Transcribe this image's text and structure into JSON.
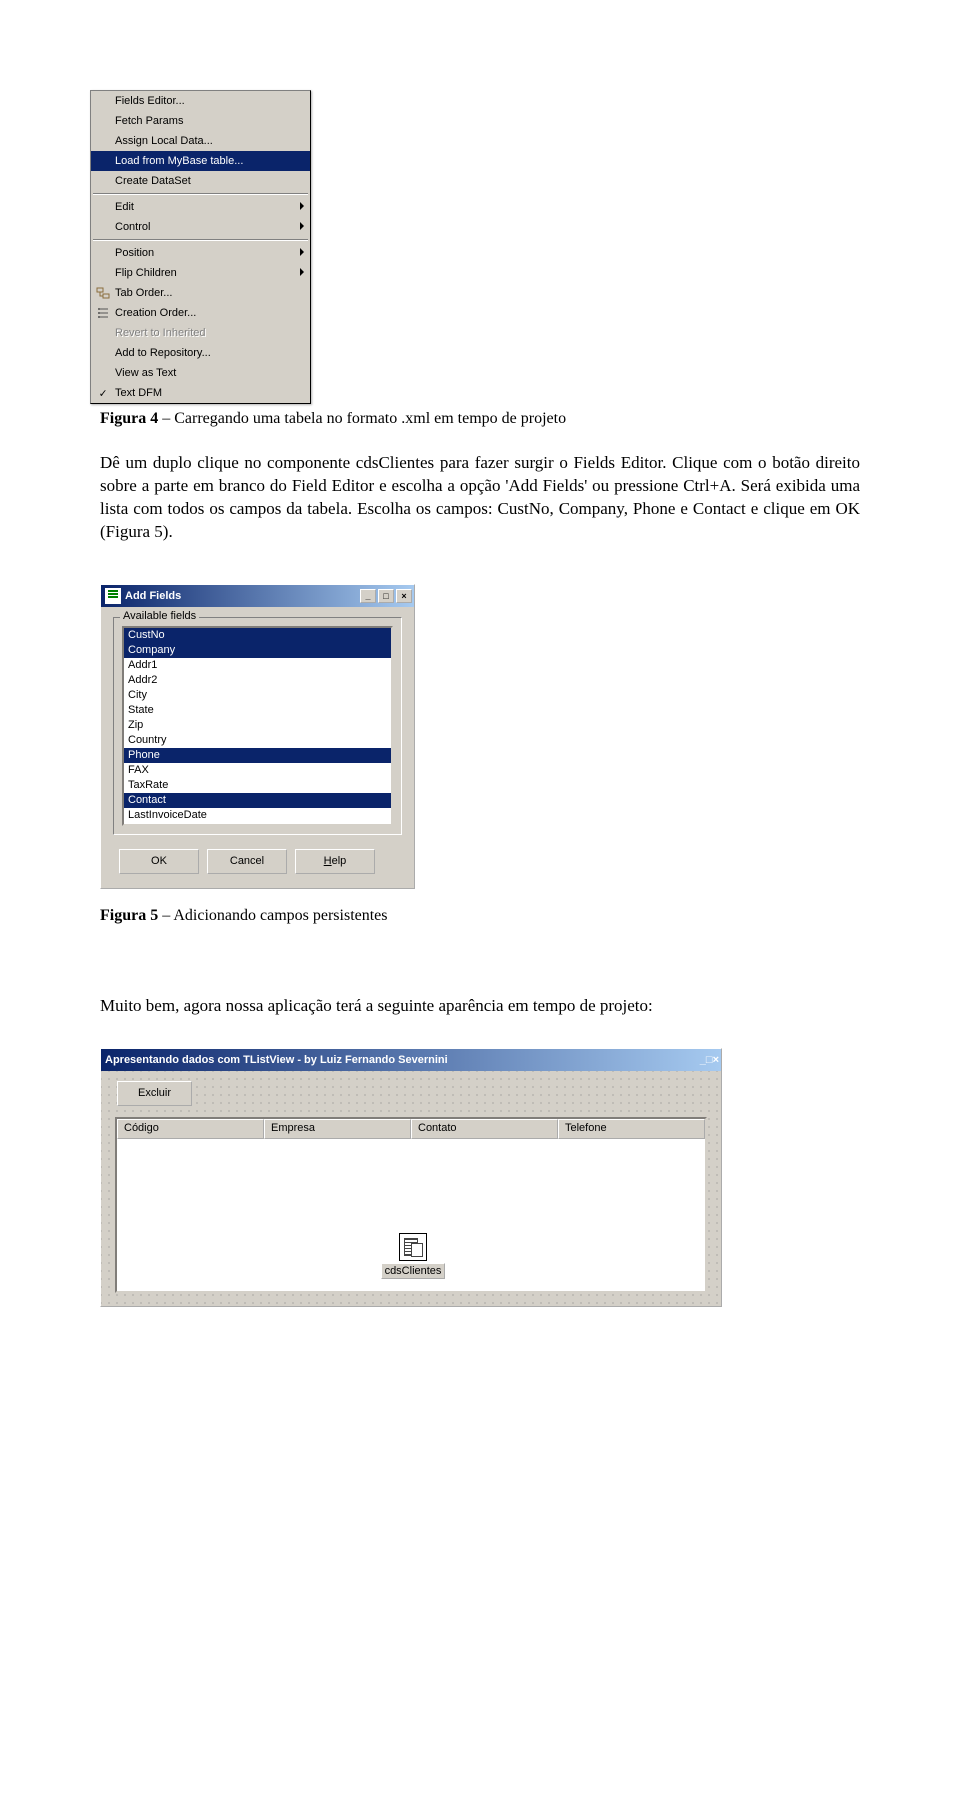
{
  "context_menu": {
    "items": [
      {
        "label": "Fields Editor...",
        "icon": "",
        "sel": false,
        "dis": false,
        "sub": false
      },
      {
        "label": "Fetch Params",
        "icon": "",
        "sel": false,
        "dis": false,
        "sub": false
      },
      {
        "label": "Assign Local Data...",
        "icon": "",
        "sel": false,
        "dis": false,
        "sub": false
      },
      {
        "label": "Load from MyBase table...",
        "icon": "",
        "sel": true,
        "dis": false,
        "sub": false
      },
      {
        "label": "Create DataSet",
        "icon": "",
        "sel": false,
        "dis": false,
        "sub": false
      }
    ],
    "group2": [
      {
        "label": "Edit",
        "sub": true
      },
      {
        "label": "Control",
        "sub": true
      }
    ],
    "group3": [
      {
        "label": "Position",
        "sub": true
      },
      {
        "label": "Flip Children",
        "sub": true
      },
      {
        "label": "Tab Order...",
        "icon": "tab-order-icon"
      },
      {
        "label": "Creation Order...",
        "icon": "creation-order-icon"
      },
      {
        "label": "Revert to Inherited",
        "dis": true
      },
      {
        "label": "Add to Repository..."
      },
      {
        "label": "View as Text"
      },
      {
        "label": "Text DFM",
        "icon": "check"
      }
    ]
  },
  "fig4_caption_bold": "Figura 4",
  "fig4_caption_rest": " – Carregando uma tabela no formato .xml em tempo de projeto",
  "paragraph": "Dê um duplo clique no componente cdsClientes para fazer surgir o Fields Editor. Clique com o botão direito sobre a parte em branco do Field Editor e escolha a opção 'Add Fields' ou pressione Ctrl+A. Será exibida uma lista com todos os campos da tabela. Escolha os campos: CustNo, Company, Phone e Contact e clique em OK (Figura 5).",
  "dlg": {
    "title": "Add Fields",
    "legend": "Available fields",
    "items": [
      {
        "label": "CustNo",
        "sel": true
      },
      {
        "label": "Company",
        "sel": true
      },
      {
        "label": "Addr1",
        "sel": false
      },
      {
        "label": "Addr2",
        "sel": false
      },
      {
        "label": "City",
        "sel": false
      },
      {
        "label": "State",
        "sel": false
      },
      {
        "label": "Zip",
        "sel": false
      },
      {
        "label": "Country",
        "sel": false
      },
      {
        "label": "Phone",
        "sel": true
      },
      {
        "label": "FAX",
        "sel": false
      },
      {
        "label": "TaxRate",
        "sel": false
      },
      {
        "label": "Contact",
        "sel": true
      },
      {
        "label": "LastInvoiceDate",
        "sel": false
      }
    ],
    "ok": "OK",
    "cancel": "Cancel",
    "help_prefix": "H",
    "help_rest": "elp"
  },
  "fig5_caption_bold": "Figura 5",
  "fig5_caption_rest": " – Adicionando campos persistentes",
  "paragraph2": "Muito bem, agora nossa aplicação terá a seguinte aparência em tempo de projeto:",
  "form": {
    "title": "Apresentando dados com TListView - by Luiz Fernando Severnini",
    "excluir": "Excluir",
    "cols": [
      "Código",
      "Empresa",
      "Contato",
      "Telefone"
    ],
    "cds": "cdsClientes"
  },
  "winbtns": {
    "min": "_",
    "max": "□",
    "close": "×"
  }
}
